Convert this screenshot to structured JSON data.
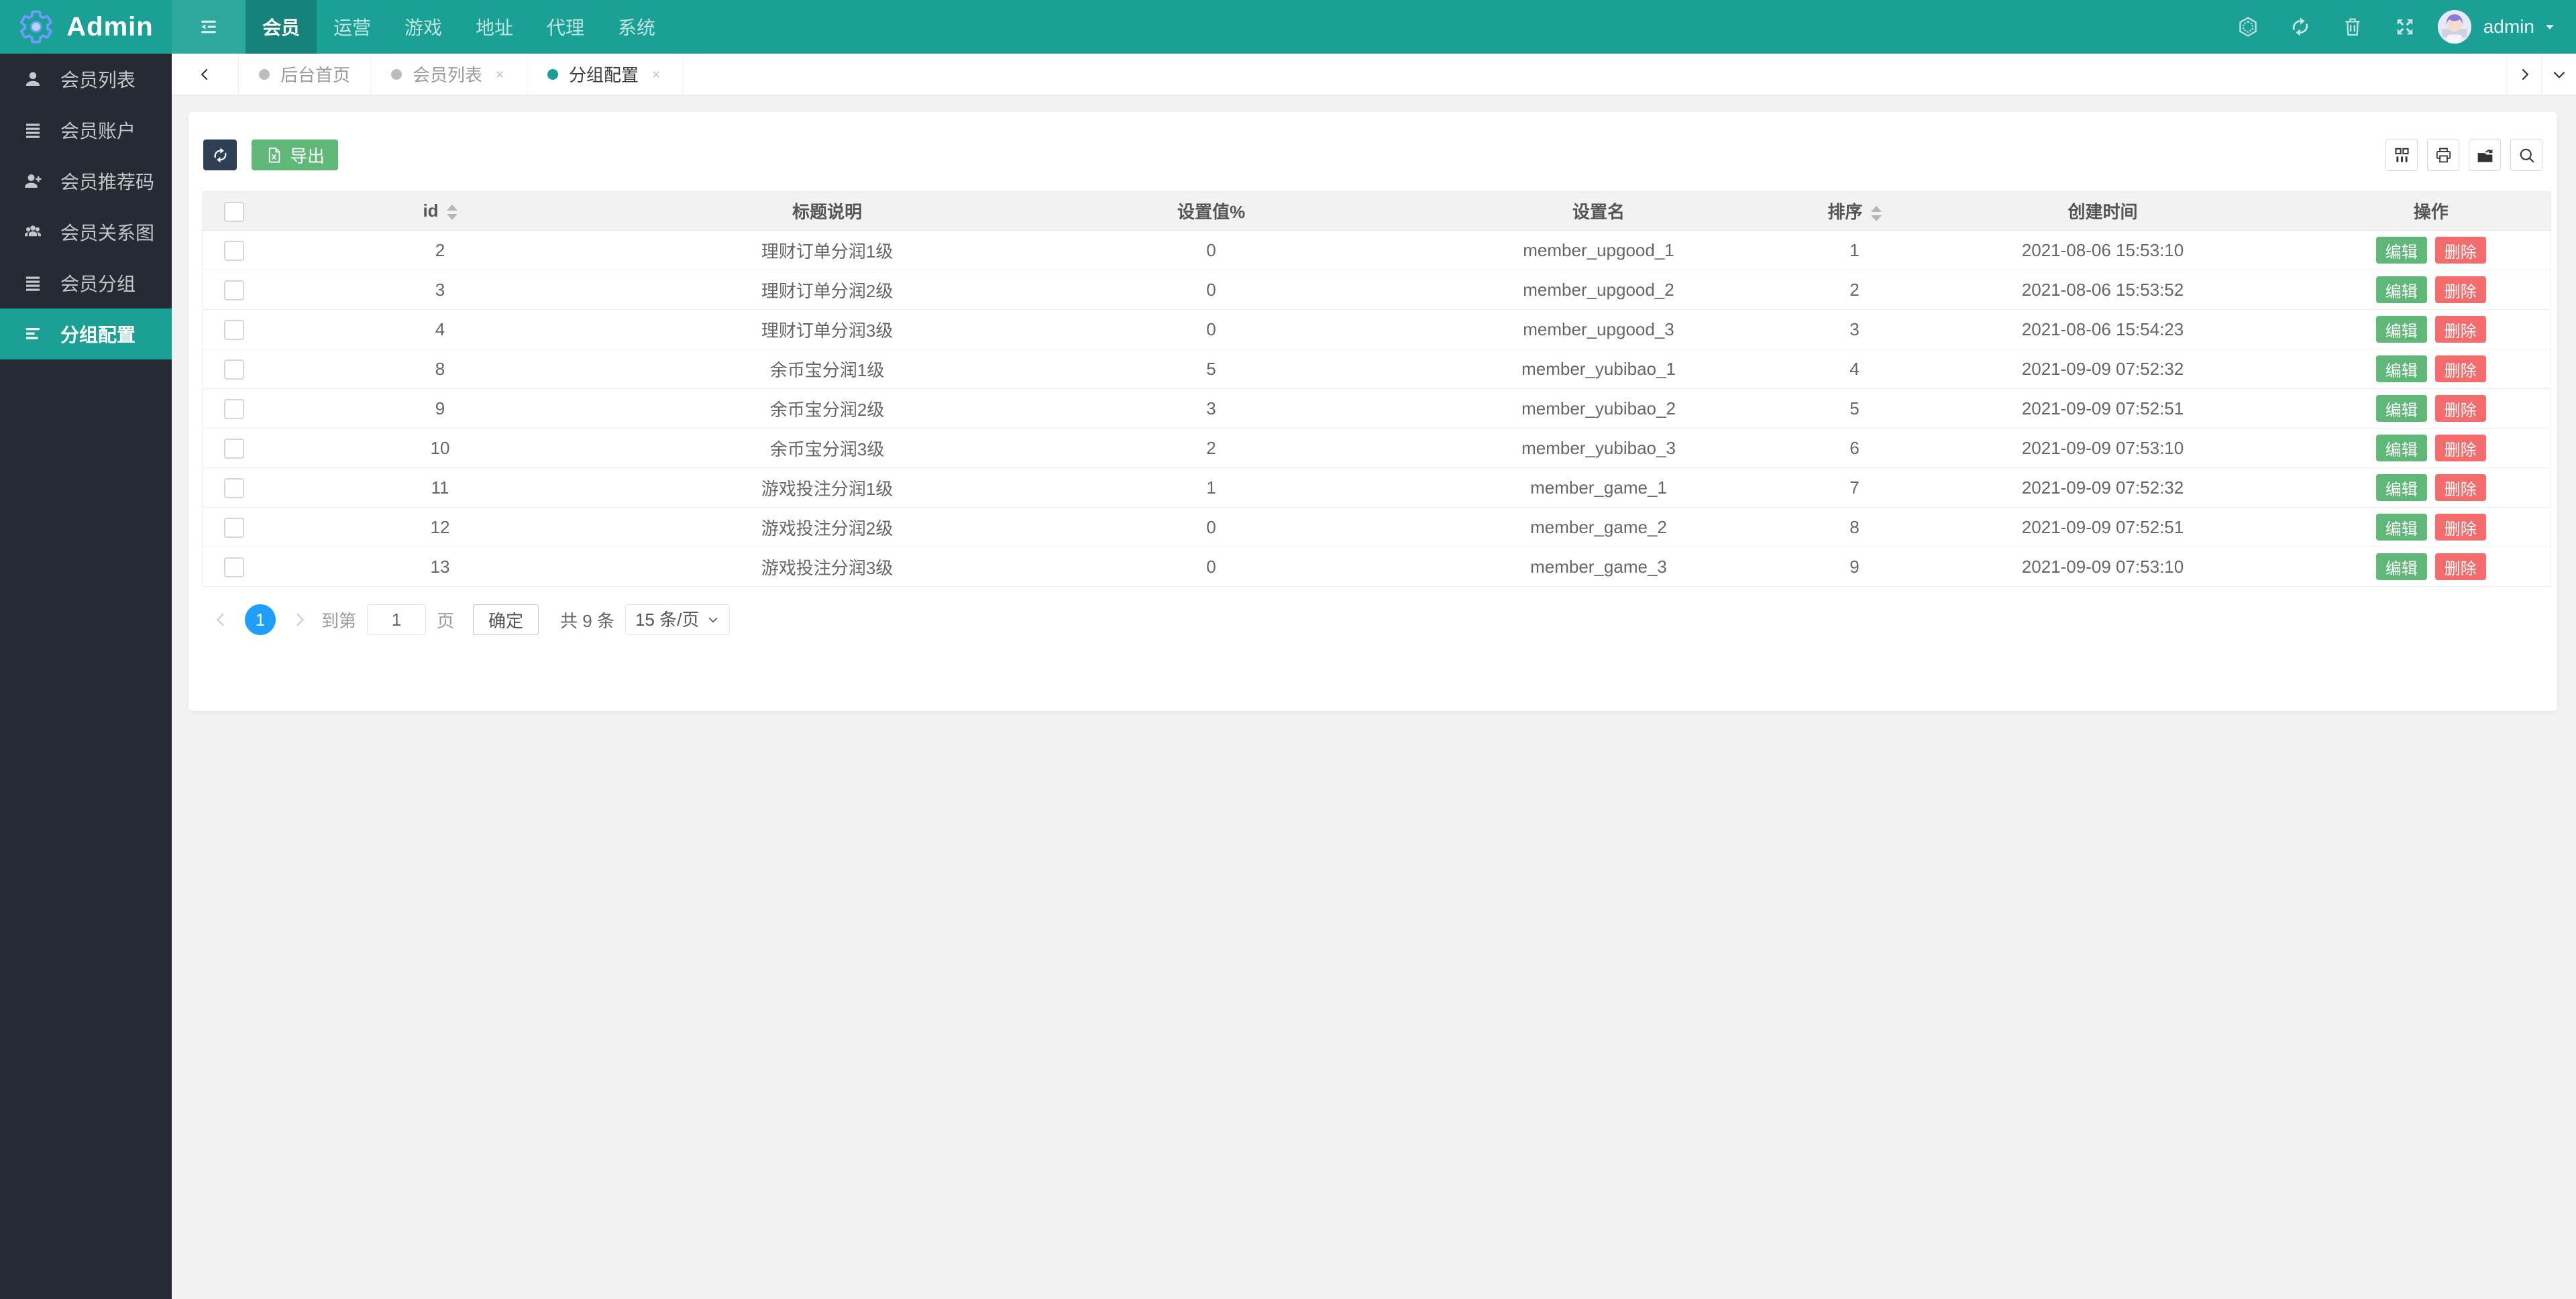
{
  "colors": {
    "accent": "#1aa094",
    "sidebar": "#262b33",
    "blue": "#1E9FFF",
    "green": "#5FB878",
    "red": "#F56C6C",
    "dark_btn": "#2f4056"
  },
  "header": {
    "brand": "Admin",
    "nav": [
      {
        "key": "member",
        "label": "会员",
        "active": true
      },
      {
        "key": "operation",
        "label": "运营",
        "active": false
      },
      {
        "key": "game",
        "label": "游戏",
        "active": false
      },
      {
        "key": "address",
        "label": "地址",
        "active": false
      },
      {
        "key": "agent",
        "label": "代理",
        "active": false
      },
      {
        "key": "system",
        "label": "系统",
        "active": false
      }
    ],
    "action_icons": [
      {
        "key": "theme",
        "icon": "hexagon"
      },
      {
        "key": "refresh",
        "icon": "refresh"
      },
      {
        "key": "clear-cache",
        "icon": "trash"
      },
      {
        "key": "fullscreen",
        "icon": "expand"
      }
    ],
    "user": "admin"
  },
  "sidebar": {
    "items": [
      {
        "key": "member-list",
        "label": "会员列表",
        "icon": "user",
        "active": false
      },
      {
        "key": "member-account",
        "label": "会员账户",
        "icon": "bars",
        "active": false
      },
      {
        "key": "member-refcode",
        "label": "会员推荐码",
        "icon": "userPlus",
        "active": false
      },
      {
        "key": "member-relation",
        "label": "会员关系图",
        "icon": "users",
        "active": false
      },
      {
        "key": "member-group",
        "label": "会员分组",
        "icon": "bars",
        "active": false
      },
      {
        "key": "group-config",
        "label": "分组配置",
        "icon": "align",
        "active": true
      }
    ]
  },
  "tabs": {
    "items": [
      {
        "key": "home",
        "label": "后台首页",
        "active": false,
        "closable": false
      },
      {
        "key": "member-list",
        "label": "会员列表",
        "active": false,
        "closable": true
      },
      {
        "key": "group-config",
        "label": "分组配置",
        "active": true,
        "closable": true
      }
    ]
  },
  "toolbar": {
    "export_label": "导出",
    "table_icons": [
      {
        "key": "filter-columns",
        "icon": "columns"
      },
      {
        "key": "print",
        "icon": "print"
      },
      {
        "key": "export-data",
        "icon": "exportFolder"
      },
      {
        "key": "search",
        "icon": "search"
      }
    ]
  },
  "table": {
    "columns": [
      "id",
      "标题说明",
      "设置值%",
      "设置名",
      "排序",
      "创建时间",
      "操作"
    ],
    "sortable_columns": [
      "id",
      "排序"
    ],
    "edit_label": "编辑",
    "delete_label": "删除",
    "rows": [
      {
        "id": "2",
        "title": "理财订单分润1级",
        "value": "0",
        "name": "member_upgood_1",
        "sort": "1",
        "created": "2021-08-06 15:53:10"
      },
      {
        "id": "3",
        "title": "理财订单分润2级",
        "value": "0",
        "name": "member_upgood_2",
        "sort": "2",
        "created": "2021-08-06 15:53:52"
      },
      {
        "id": "4",
        "title": "理财订单分润3级",
        "value": "0",
        "name": "member_upgood_3",
        "sort": "3",
        "created": "2021-08-06 15:54:23"
      },
      {
        "id": "8",
        "title": "余币宝分润1级",
        "value": "5",
        "name": "member_yubibao_1",
        "sort": "4",
        "created": "2021-09-09 07:52:32"
      },
      {
        "id": "9",
        "title": "余币宝分润2级",
        "value": "3",
        "name": "member_yubibao_2",
        "sort": "5",
        "created": "2021-09-09 07:52:51"
      },
      {
        "id": "10",
        "title": "余币宝分润3级",
        "value": "2",
        "name": "member_yubibao_3",
        "sort": "6",
        "created": "2021-09-09 07:53:10"
      },
      {
        "id": "11",
        "title": "游戏投注分润1级",
        "value": "1",
        "name": "member_game_1",
        "sort": "7",
        "created": "2021-09-09 07:52:32"
      },
      {
        "id": "12",
        "title": "游戏投注分润2级",
        "value": "0",
        "name": "member_game_2",
        "sort": "8",
        "created": "2021-09-09 07:52:51"
      },
      {
        "id": "13",
        "title": "游戏投注分润3级",
        "value": "0",
        "name": "member_game_3",
        "sort": "9",
        "created": "2021-09-09 07:53:10"
      }
    ]
  },
  "pagination": {
    "current": "1",
    "goto_label": "到第",
    "goto_value": "1",
    "page_unit": "页",
    "confirm_label": "确定",
    "total_label": "共 9 条",
    "page_size": "15 条/页"
  }
}
